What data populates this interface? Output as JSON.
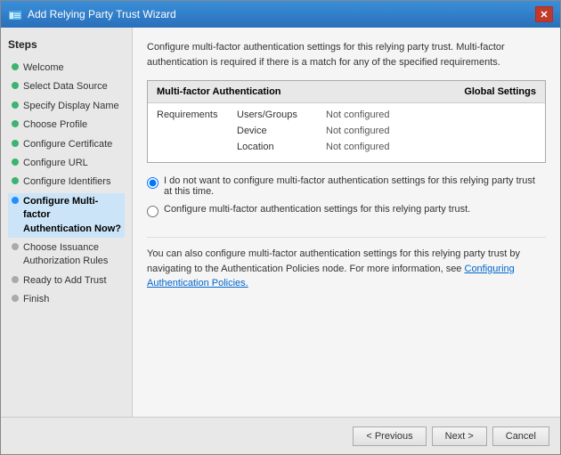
{
  "window": {
    "title": "Add Relying Party Trust Wizard",
    "close_label": "✕"
  },
  "sidebar": {
    "title": "Steps",
    "items": [
      {
        "id": "welcome",
        "label": "Welcome",
        "dot": "green"
      },
      {
        "id": "select-data-source",
        "label": "Select Data Source",
        "dot": "green"
      },
      {
        "id": "specify-display-name",
        "label": "Specify Display Name",
        "dot": "green"
      },
      {
        "id": "choose-profile",
        "label": "Choose Profile",
        "dot": "green"
      },
      {
        "id": "configure-certificate",
        "label": "Configure Certificate",
        "dot": "green"
      },
      {
        "id": "configure-url",
        "label": "Configure URL",
        "dot": "green"
      },
      {
        "id": "configure-identifiers",
        "label": "Configure Identifiers",
        "dot": "green"
      },
      {
        "id": "configure-mfa",
        "label": "Configure Multi-factor Authentication Now?",
        "dot": "blue",
        "active": true
      },
      {
        "id": "choose-issuance",
        "label": "Choose Issuance Authorization Rules",
        "dot": "gray"
      },
      {
        "id": "ready-to-add",
        "label": "Ready to Add Trust",
        "dot": "gray"
      },
      {
        "id": "finish",
        "label": "Finish",
        "dot": "gray"
      }
    ]
  },
  "main": {
    "description": "Configure multi-factor authentication settings for this relying party trust. Multi-factor authentication is required if there is a match for any of the specified requirements.",
    "mfa_box": {
      "header_left": "Multi-factor Authentication",
      "header_right": "Global Settings",
      "requirements_label": "Requirements",
      "rows": [
        {
          "name": "Users/Groups",
          "value": "Not configured"
        },
        {
          "name": "Device",
          "value": "Not configured"
        },
        {
          "name": "Location",
          "value": "Not configured"
        }
      ]
    },
    "radio_options": [
      {
        "id": "radio-no-configure",
        "label": "I do not want to configure multi-factor authentication settings for this relying party trust at this time.",
        "selected": true
      },
      {
        "id": "radio-configure",
        "label": "Configure multi-factor authentication settings for this relying party trust.",
        "selected": false
      }
    ],
    "info_text_before": "You can also configure multi-factor authentication settings for this relying party trust by navigating to the Authentication Policies node. For more information, see ",
    "info_link": "Configuring Authentication Policies.",
    "info_text_after": ""
  },
  "footer": {
    "previous_label": "< Previous",
    "next_label": "Next >",
    "cancel_label": "Cancel"
  }
}
